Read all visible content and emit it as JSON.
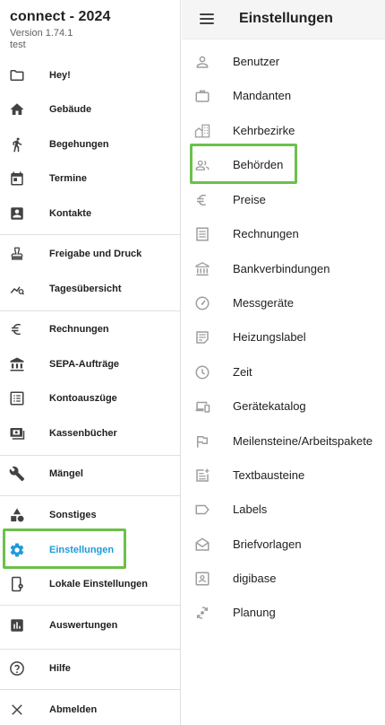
{
  "app": {
    "title": "connect - 2024",
    "version": "Version 1.74.1",
    "user": "test"
  },
  "nav": {
    "hey": "Hey!",
    "gebaeude": "Gebäude",
    "begehungen": "Begehungen",
    "termine": "Termine",
    "kontakte": "Kontakte",
    "freigabe": "Freigabe und Druck",
    "tagesuebersicht": "Tagesübersicht",
    "rechnungen": "Rechnungen",
    "sepa": "SEPA-Aufträge",
    "kontoauszuege": "Kontoauszüge",
    "kassenbuecher": "Kassenbücher",
    "maengel": "Mängel",
    "sonstiges": "Sonstiges",
    "einstellungen": "Einstellungen",
    "lokale": "Lokale Einstellungen",
    "auswertungen": "Auswertungen",
    "hilfe": "Hilfe",
    "abmelden": "Abmelden"
  },
  "settings": {
    "title": "Einstellungen",
    "items": [
      {
        "label": "Benutzer",
        "icon": "person-icon"
      },
      {
        "label": "Mandanten",
        "icon": "briefcase-icon"
      },
      {
        "label": "Kehrbezirke",
        "icon": "buildings-icon"
      },
      {
        "label": "Behörden",
        "icon": "people-icon"
      },
      {
        "label": "Preise",
        "icon": "euro-icon"
      },
      {
        "label": "Rechnungen",
        "icon": "invoice-icon"
      },
      {
        "label": "Bankverbindungen",
        "icon": "bank-icon"
      },
      {
        "label": "Messgeräte",
        "icon": "gauge-icon"
      },
      {
        "label": "Heizungslabel",
        "icon": "note-icon"
      },
      {
        "label": "Zeit",
        "icon": "clock-icon"
      },
      {
        "label": "Gerätekatalog",
        "icon": "devices-icon"
      },
      {
        "label": "Meilensteine/Arbeitspakete",
        "icon": "flag-icon"
      },
      {
        "label": "Textbausteine",
        "icon": "post-add-icon"
      },
      {
        "label": "Labels",
        "icon": "label-icon"
      },
      {
        "label": "Briefvorlagen",
        "icon": "envelope-icon"
      },
      {
        "label": "digibase",
        "icon": "contact-box-icon"
      },
      {
        "label": "Planung",
        "icon": "sync-icon"
      }
    ]
  },
  "colors": {
    "accent": "#1e9bd7",
    "highlight": "#6cc04a",
    "icon_gray": "#9e9e9e"
  }
}
